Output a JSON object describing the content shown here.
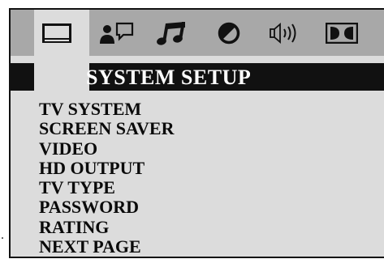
{
  "header": {
    "title": "SYSTEM SETUP"
  },
  "tabs": [
    {
      "icon": "tv-monitor-icon"
    },
    {
      "icon": "language-speech-icon"
    },
    {
      "icon": "audio-music-note-icon"
    },
    {
      "icon": "video-contrast-icon"
    },
    {
      "icon": "speaker-volume-icon"
    },
    {
      "icon": "dolby-digital-icon"
    }
  ],
  "menu": {
    "items": [
      {
        "label": "TV SYSTEM"
      },
      {
        "label": "SCREEN SAVER"
      },
      {
        "label": "VIDEO"
      },
      {
        "label": "HD OUTPUT"
      },
      {
        "label": "TV TYPE"
      },
      {
        "label": "PASSWORD"
      },
      {
        "label": "RATING"
      },
      {
        "label": "NEXT PAGE"
      }
    ]
  },
  "stray_mark": ".",
  "colors": {
    "panel": "#dcdcdc",
    "tab_strip": "#a8a8a8",
    "title_bar": "#111111",
    "title_text": "#ffffff"
  }
}
